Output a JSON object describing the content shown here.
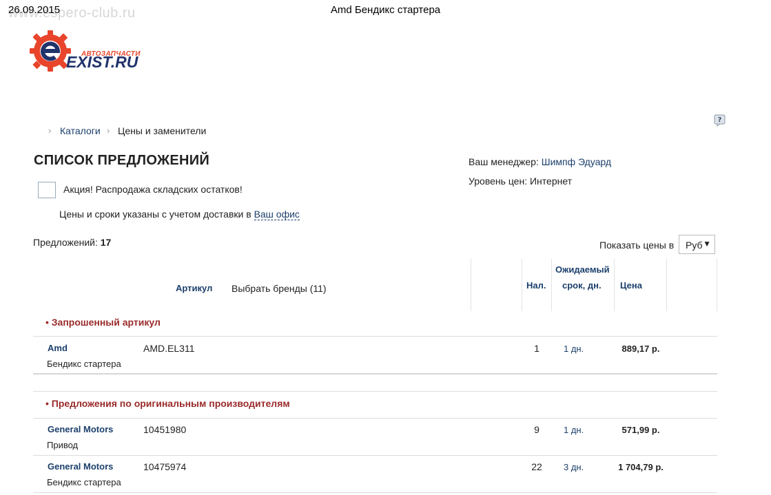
{
  "header": {
    "date": "26.09.2015",
    "watermark": "www.espero-club.ru",
    "title": "Amd Бендикс стартера"
  },
  "logo": {
    "subtitle": "АВТОЗАПЧАСТИ",
    "name": "EXIST.RU"
  },
  "breadcrumb": [
    {
      "label": "Каталоги"
    },
    {
      "label": "Цены и заменители"
    }
  ],
  "page_title": "СПИСОК ПРЕДЛОЖЕНИЙ",
  "promo": {
    "label": "Акция! Распродажа складских остатков!"
  },
  "delivery": {
    "text": "Цены и сроки указаны с учетом доставки в",
    "link": "Ваш офис"
  },
  "manager": {
    "label": "Ваш менеджер:",
    "name": "Шимпф Эдуард",
    "price_level_label": "Уровень цен:",
    "price_level": "Интернет"
  },
  "offers": {
    "label": "Предложений:",
    "count": "17"
  },
  "currency": {
    "label": "Показать цены в",
    "selected": "Руб"
  },
  "table_header": {
    "article": "Артикул",
    "brands": "Выбрать бренды (11)",
    "stock": "Нал.",
    "expected_1": "Ожидаемый",
    "expected_2": "срок, дн.",
    "price": "Цена"
  },
  "sections": [
    {
      "title": "• Запрошенный артикул",
      "rows": [
        {
          "brand": "Amd",
          "desc": "Бендикс стартера",
          "article": "AMD.EL311",
          "qty": "1",
          "days": "1 дн.",
          "price": "889,17 р."
        }
      ]
    },
    {
      "title": "• Предложения по оригинальным производителям",
      "rows": [
        {
          "brand": "General Motors",
          "desc": "Привод",
          "article": "10451980",
          "qty": "9",
          "days": "1 дн.",
          "price": "571,99 р."
        },
        {
          "brand": "General Motors",
          "desc": "Бендикс стартера",
          "article": "10475974",
          "qty": "22",
          "days": "3 дн.",
          "price": "1 704,79 р."
        }
      ]
    }
  ],
  "colors": {
    "accent": "#1b3f6b",
    "section": "#9a2a2a",
    "logo_red": "#e8452c",
    "logo_navy": "#21336b"
  }
}
